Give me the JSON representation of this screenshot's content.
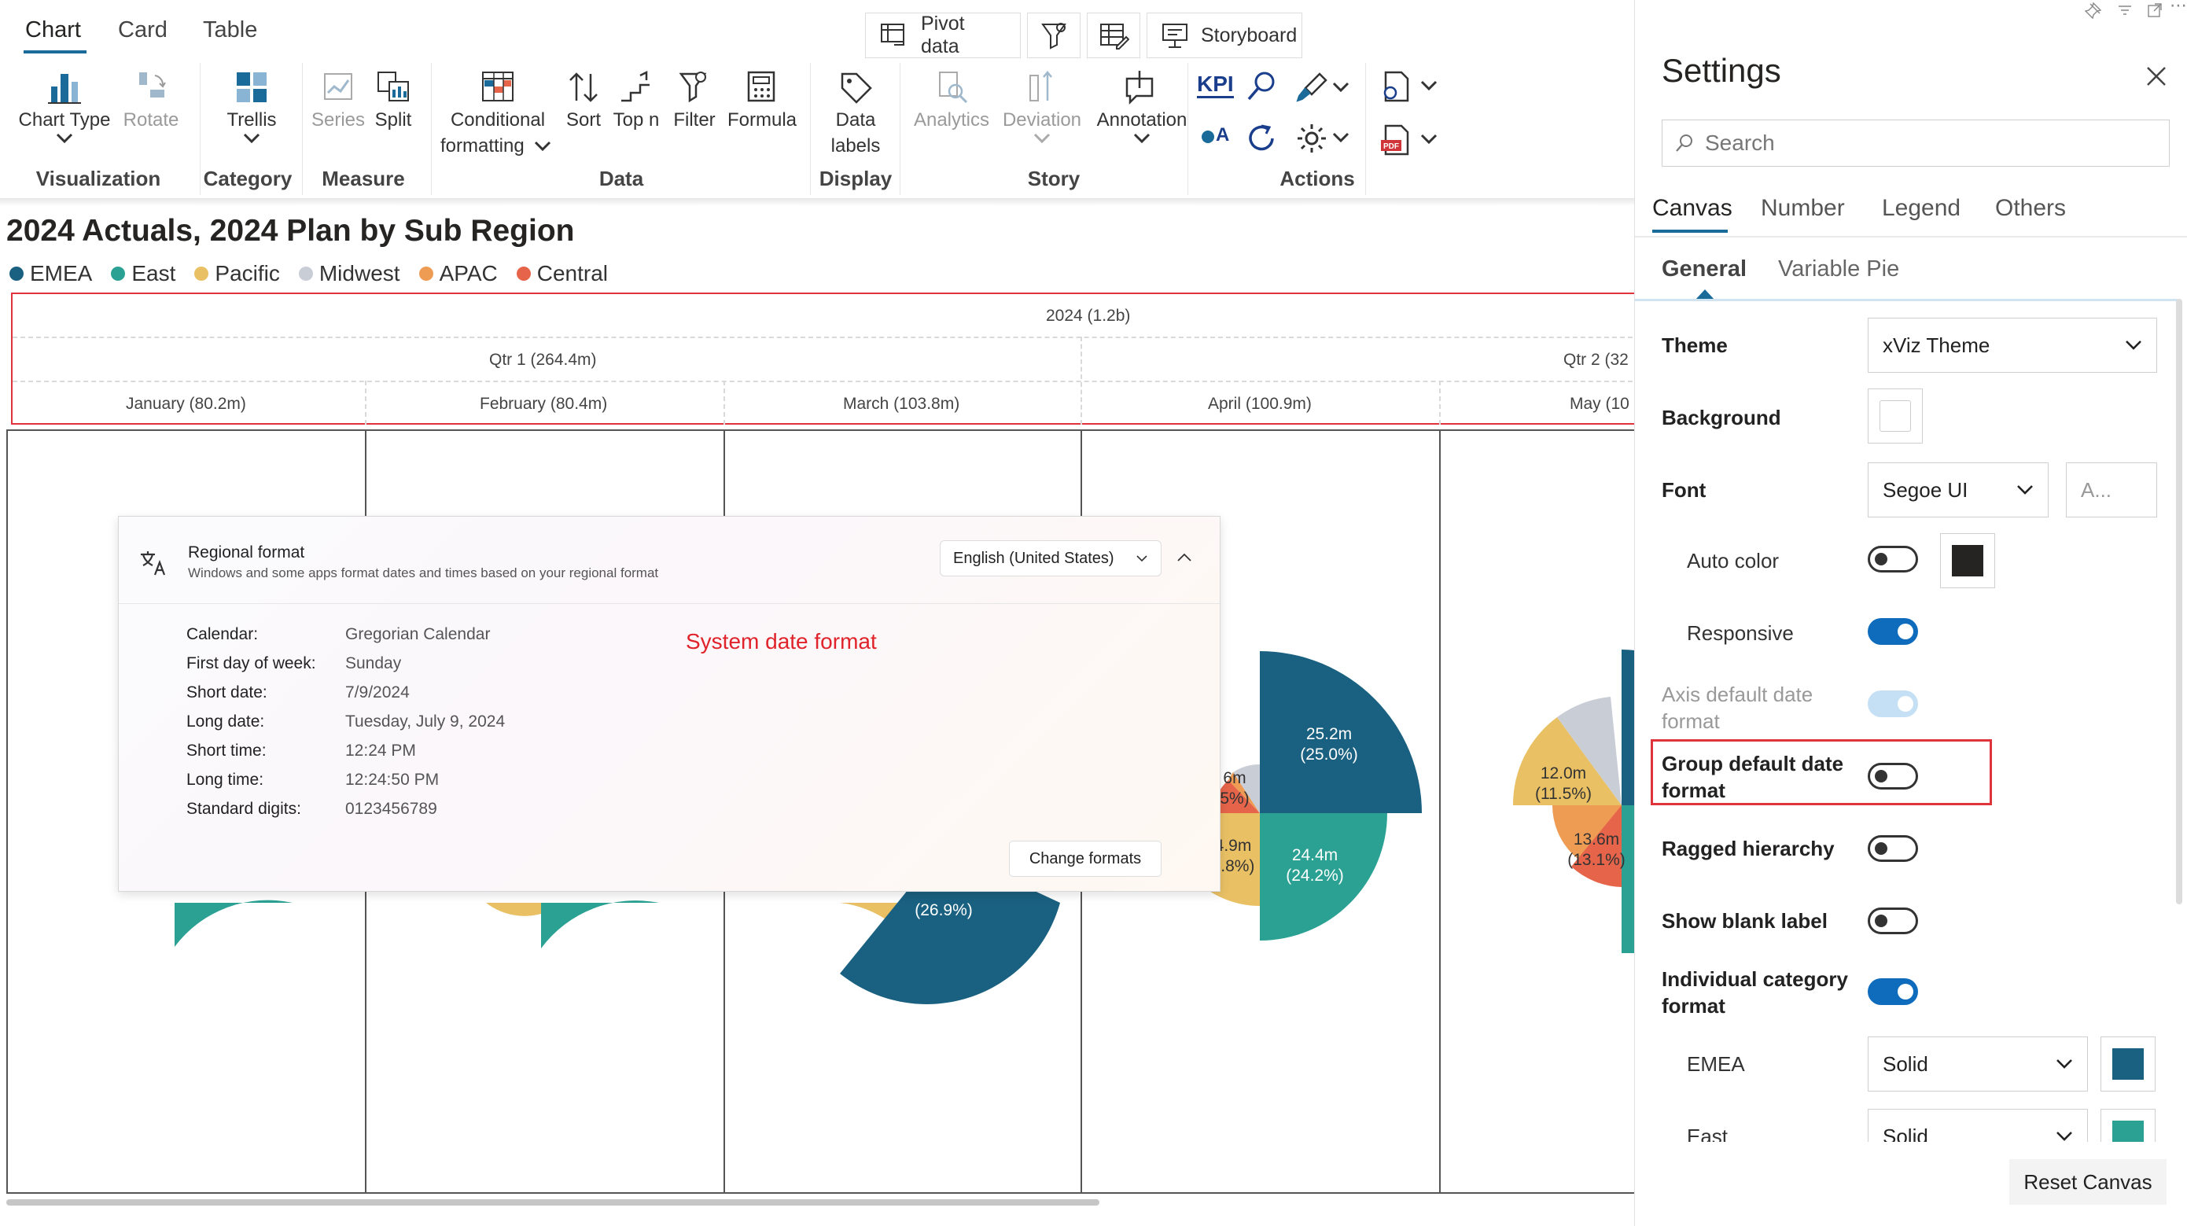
{
  "tabs": [
    "Chart",
    "Card",
    "Table"
  ],
  "top_buttons": {
    "pivot": "Pivot data",
    "storyboard": "Storyboard"
  },
  "ribbon": {
    "chart_type": "Chart Type",
    "rotate": "Rotate",
    "trellis": "Trellis",
    "series": "Series",
    "split": "Split",
    "cond1": "Conditional",
    "cond2": "formatting",
    "sort": "Sort",
    "topn": "Top n",
    "filter": "Filter",
    "formula": "Formula",
    "data1": "Data",
    "data2": "labels",
    "analytics": "Analytics",
    "deviation": "Deviation",
    "annotation": "Annotation",
    "kpi": "KPI",
    "qa": "A"
  },
  "groups": {
    "visualization": "Visualization",
    "category": "Category",
    "measure": "Measure",
    "data": "Data",
    "display": "Display",
    "story": "Story",
    "actions": "Actions"
  },
  "chart": {
    "title": "2024 Actuals, 2024 Plan by Sub Region",
    "legend": [
      {
        "name": "EMEA",
        "color": "#1a6080"
      },
      {
        "name": "East",
        "color": "#2aa193"
      },
      {
        "name": "Pacific",
        "color": "#e9c064"
      },
      {
        "name": "Midwest",
        "color": "#c9cdd6"
      },
      {
        "name": "APAC",
        "color": "#ee9b54"
      },
      {
        "name": "Central",
        "color": "#e5644a"
      }
    ],
    "header_year": "2024 (1.2b)",
    "header_q1": "Qtr 1 (264.4m)",
    "header_q2": "Qtr 2 (32",
    "months": [
      "January (80.2m)",
      "February (80.4m)",
      "March (103.8m)",
      "April (100.9m)",
      "May (10"
    ],
    "labels": {
      "april_emea_v": "25.2m",
      "april_emea_p": "(25.0%)",
      "april_east_v": "24.4m",
      "april_east_p": "(24.2%)",
      "april_l1": "6m",
      "april_l2": "5%)",
      "april_l3": "4.9m",
      "april_l4": "4.8%)",
      "march_emea_p": "(26.9%)",
      "may_pac_v": "12.0m",
      "may_pac_p": "(11.5%)",
      "may_cen_v": "13.6m",
      "may_cen_p": "(13.1%)"
    },
    "annotation": "System date format"
  },
  "regional": {
    "title": "Regional format",
    "subtitle": "Windows and some apps format dates and times based on your regional format",
    "locale": "English (United States)",
    "rows": [
      {
        "label": "Calendar:",
        "value": "Gregorian Calendar"
      },
      {
        "label": "First day of week:",
        "value": "Sunday"
      },
      {
        "label": "Short date:",
        "value": "7/9/2024"
      },
      {
        "label": "Long date:",
        "value": "Tuesday, July 9, 2024"
      },
      {
        "label": "Short time:",
        "value": "12:24 PM"
      },
      {
        "label": "Long time:",
        "value": "12:24:50 PM"
      },
      {
        "label": "Standard digits:",
        "value": "0123456789"
      }
    ],
    "change_button": "Change formats"
  },
  "settings": {
    "title": "Settings",
    "search_placeholder": "Search",
    "tabs": [
      "Canvas",
      "Number",
      "Legend",
      "Others"
    ],
    "subtabs": [
      "General",
      "Variable Pie"
    ],
    "theme_label": "Theme",
    "theme_value": "xViz Theme",
    "background_label": "Background",
    "font_label": "Font",
    "font_value": "Segoe UI",
    "font_size_placeholder": "A...",
    "auto_color": "Auto color",
    "responsive": "Responsive",
    "axis_default1": "Axis default date",
    "axis_default2": "format",
    "group_default1": "Group default date",
    "group_default2": "format",
    "ragged": "Ragged hierarchy",
    "blank": "Show blank label",
    "individual1": "Individual category",
    "individual2": "format",
    "emea": "EMEA",
    "emea_fill": "Solid",
    "emea_color": "#1a6080",
    "east": "East",
    "east_fill": "Solid",
    "east_color": "#2aa193",
    "reset": "Reset Canvas"
  }
}
